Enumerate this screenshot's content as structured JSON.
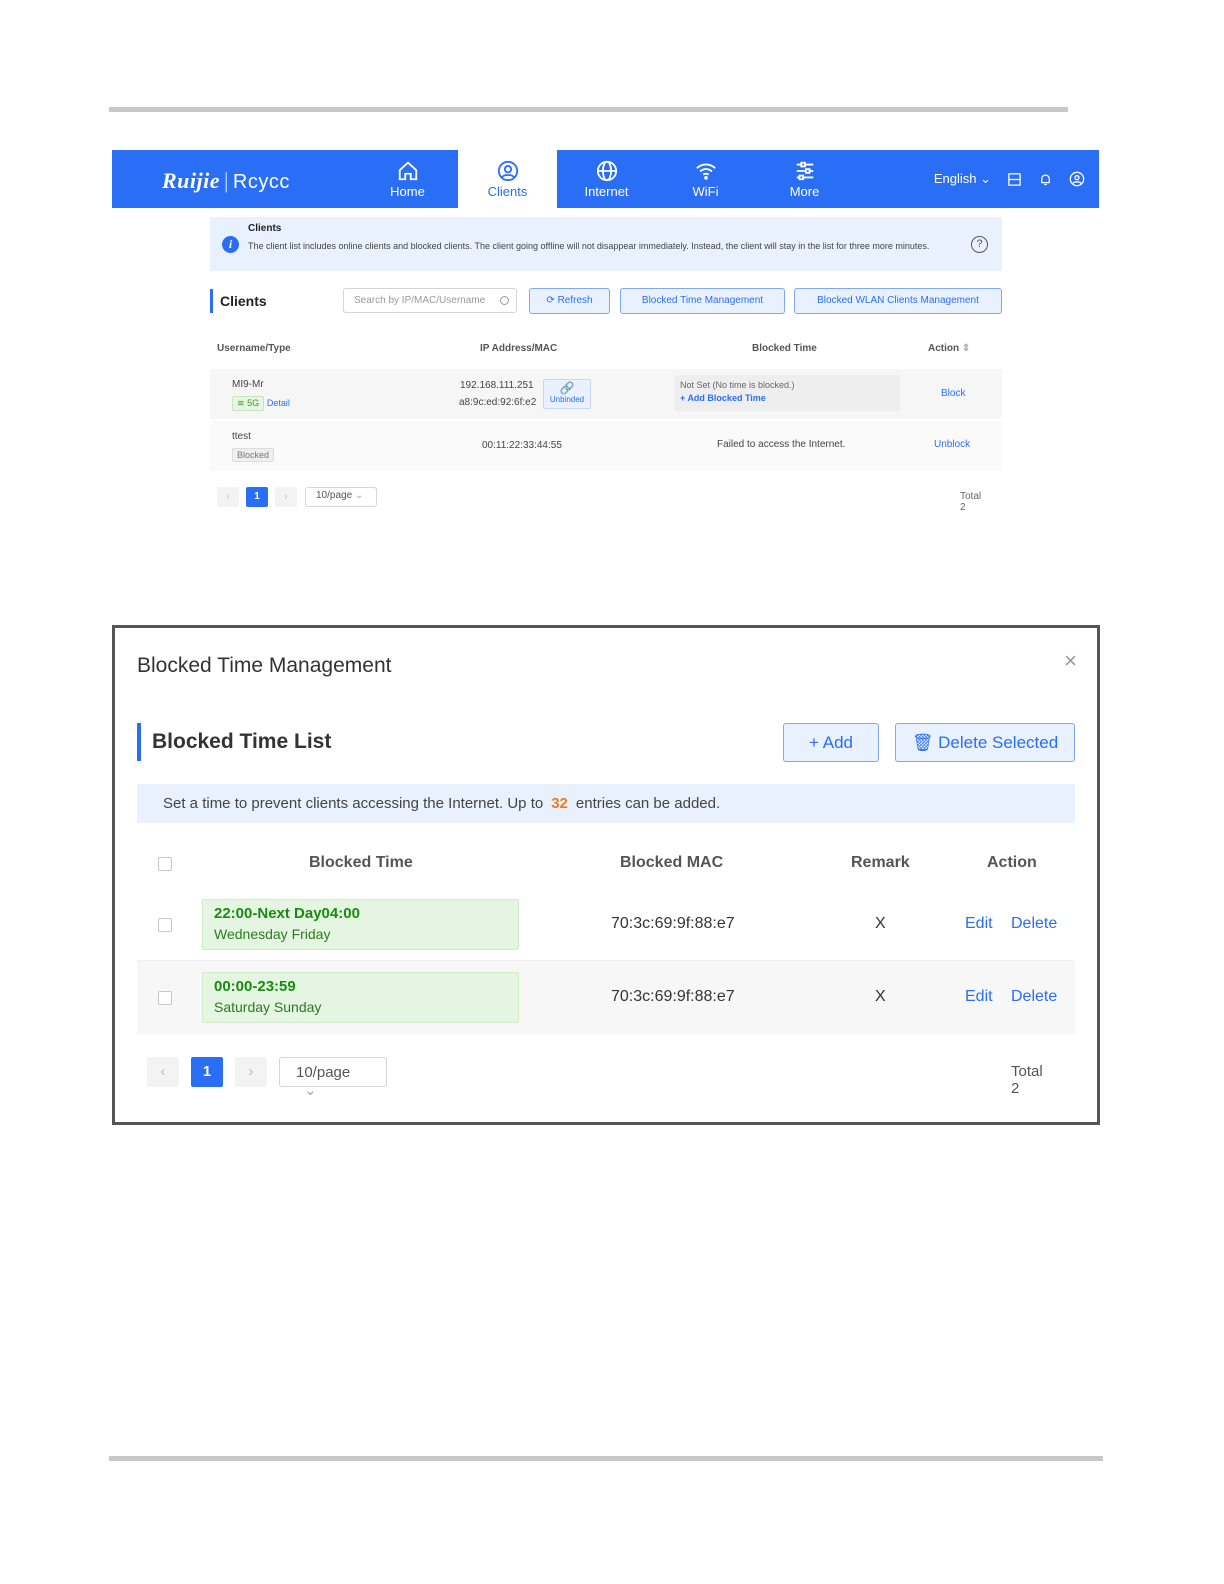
{
  "router_ui": {
    "brand": {
      "logo": "Ruijie",
      "separator": "|",
      "sub": "Rcycc"
    },
    "nav_tabs": [
      {
        "label": "Home",
        "icon": "home-icon"
      },
      {
        "label": "Clients",
        "icon": "user-icon"
      },
      {
        "label": "Internet",
        "icon": "globe-icon"
      },
      {
        "label": "WiFi",
        "icon": "wifi-icon"
      },
      {
        "label": "More",
        "icon": "sliders-icon"
      }
    ],
    "language": "English",
    "info": {
      "title": "Clients",
      "text": "The client list includes online clients and blocked clients. The client going offline will not disappear immediately. Instead, the client will stay in the list for three more minutes."
    },
    "section_title": "Clients",
    "search_placeholder": "Search by IP/MAC/Username",
    "buttons": {
      "refresh": "Refresh",
      "blocked_time": "Blocked Time Management",
      "blocked_wlan": "Blocked WLAN Clients Management"
    },
    "columns": [
      "Username/Type",
      "IP Address/MAC",
      "Blocked Time",
      "Action"
    ],
    "rows": [
      {
        "name": "MI9-Mr",
        "band": "5G",
        "detail": "Detail",
        "ip": "192.168.111.251",
        "mac": "a8:9c:ed:92:6f:e2",
        "bind_label": "Unbinded",
        "blocked_time": "Not Set (No time is blocked.)",
        "add_time": "Add Blocked Time",
        "action": "Block"
      },
      {
        "name": "ttest",
        "status": "Blocked",
        "mac": "00:11:22:33:44:55",
        "blocked_time": "Failed to access the Internet.",
        "action": "Unblock"
      }
    ],
    "pagination": {
      "page": "1",
      "per_page": "10/page",
      "total": "Total 2"
    }
  },
  "modal": {
    "title": "Blocked Time Management",
    "close": "×",
    "section_title": "Blocked Time List",
    "add_button": "+ Add",
    "delete_button": "Delete Selected",
    "info_before": "Set a time to prevent clients accessing the Internet. Up to",
    "info_count": "32",
    "info_after": "entries can be added.",
    "columns": [
      "Blocked Time",
      "Blocked MAC",
      "Remark",
      "Action"
    ],
    "rows": [
      {
        "time": "22:00-Next Day04:00",
        "days": "Wednesday Friday",
        "mac": "70:3c:69:9f:88:e7",
        "remark": "X",
        "edit": "Edit",
        "delete": "Delete"
      },
      {
        "time": "00:00-23:59",
        "days": "Saturday Sunday",
        "mac": "70:3c:69:9f:88:e7",
        "remark": "X",
        "edit": "Edit",
        "delete": "Delete"
      }
    ],
    "pagination": {
      "page": "1",
      "per_page": "10/page",
      "total": "Total 2"
    }
  }
}
